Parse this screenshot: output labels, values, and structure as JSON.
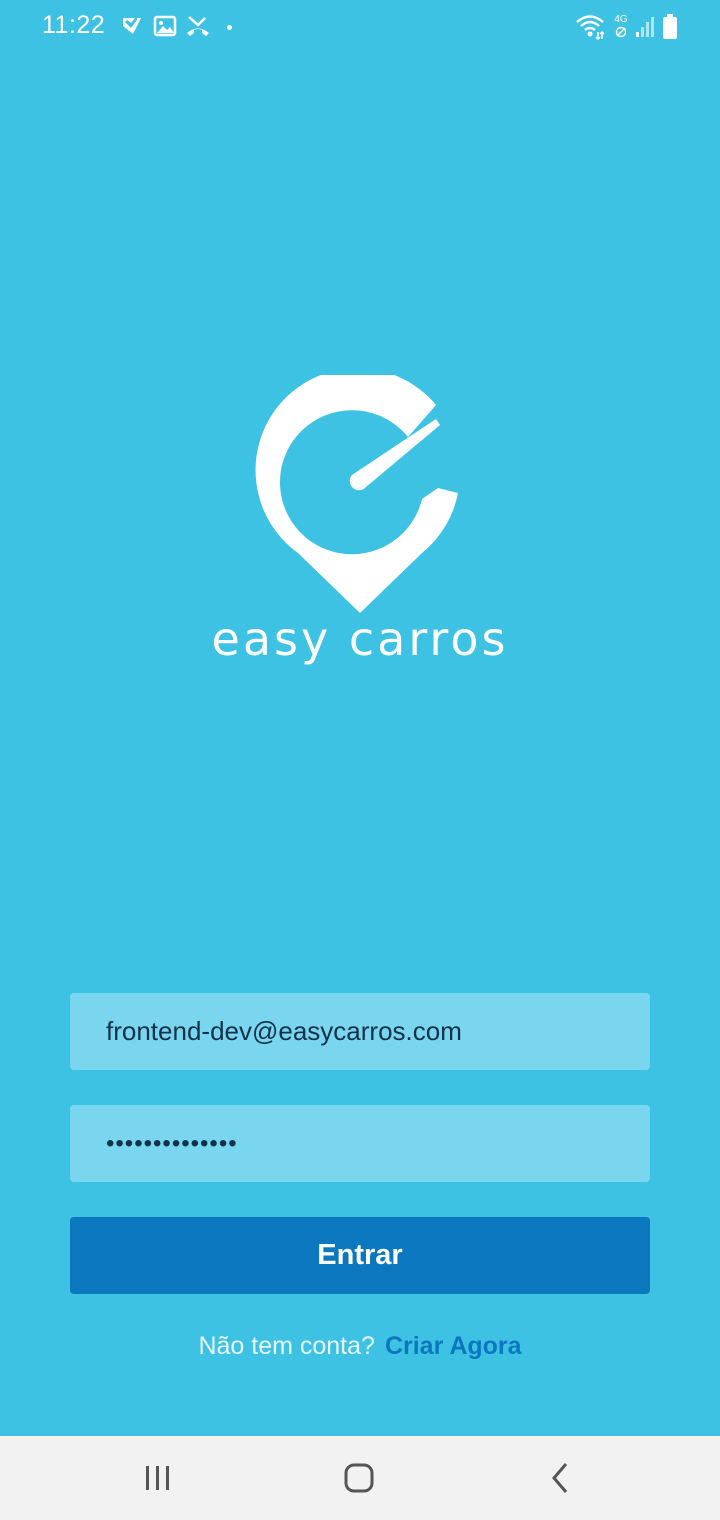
{
  "status_bar": {
    "time": "11:22",
    "left_icons": [
      "checkbox-icon",
      "image-icon",
      "missed-call-icon",
      "dot-icon"
    ],
    "right_icons": [
      "wifi-icon",
      "4g-icon",
      "signal-icon",
      "battery-icon"
    ],
    "network_label": "4G"
  },
  "logo": {
    "icon": "speedometer-pin-logo",
    "text": "easy carros"
  },
  "form": {
    "email_value": "frontend-dev@easycarros.com",
    "password_value": "••••••••••••••",
    "login_label": "Entrar"
  },
  "signup": {
    "prompt": "Não tem conta?",
    "link": "Criar Agora"
  },
  "nav_bar": {
    "items": [
      "recent-apps-icon",
      "home-icon",
      "back-icon"
    ]
  },
  "colors": {
    "background": "#3EC2E3",
    "field_bg": "#7AD5EE",
    "primary": "#0A77BF",
    "nav_bg": "#F2F2F2"
  }
}
